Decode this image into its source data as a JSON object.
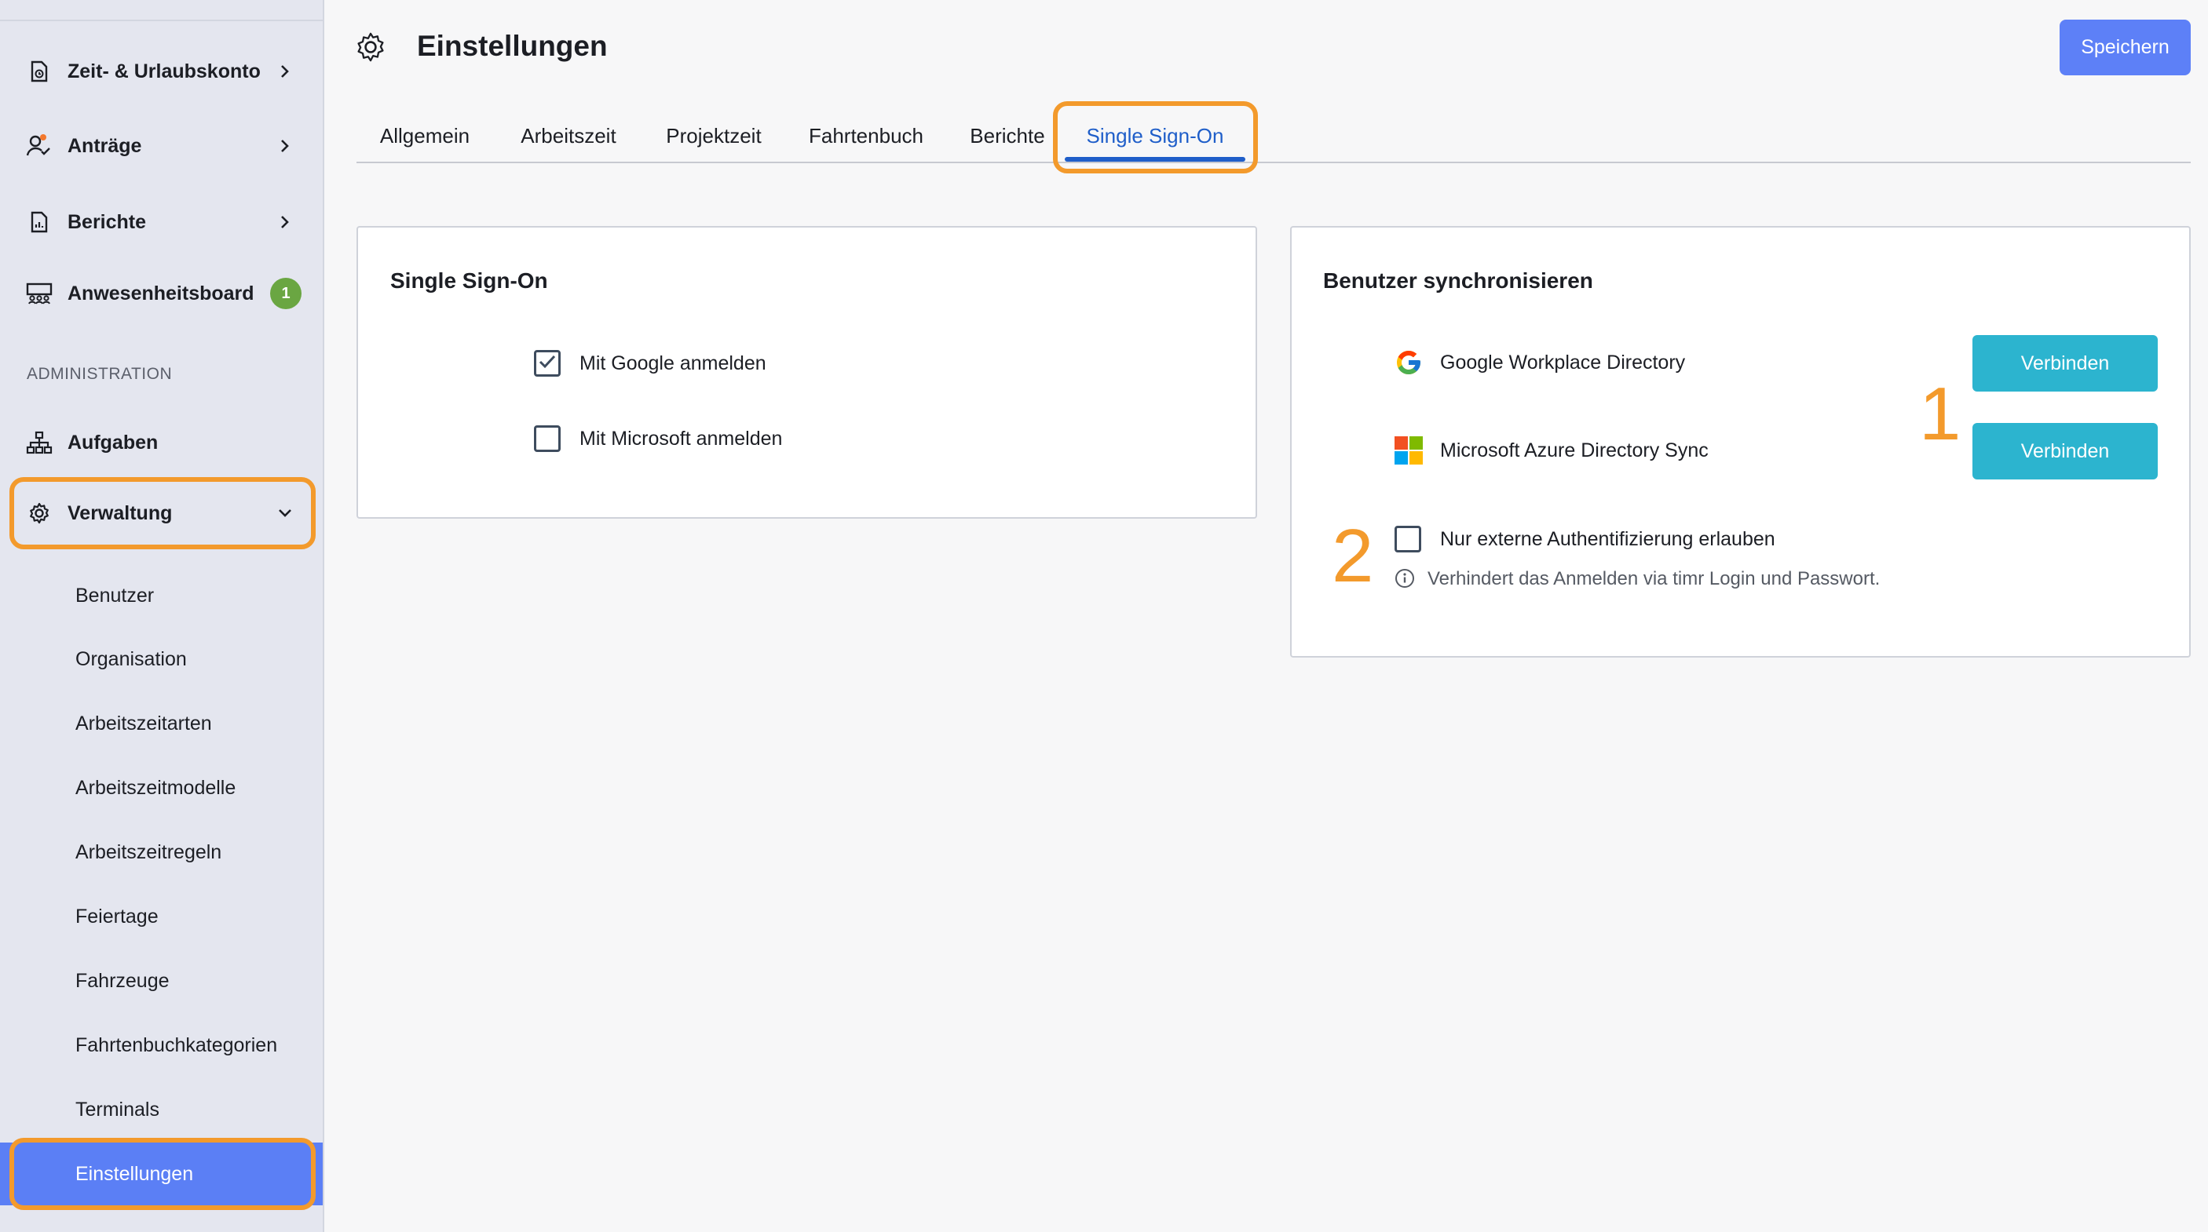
{
  "sidebar": {
    "items": [
      {
        "label": "Zeit- & Urlaubskonto",
        "icon": "document-clock-icon"
      },
      {
        "label": "Anträge",
        "icon": "user-check-icon"
      },
      {
        "label": "Berichte",
        "icon": "report-document-icon"
      },
      {
        "label": "Anwesenheitsboard",
        "icon": "presence-board-icon",
        "badge": "1"
      }
    ],
    "section_label": "ADMINISTRATION",
    "admin_items": [
      {
        "label": "Aufgaben",
        "icon": "hierarchy-icon"
      },
      {
        "label": "Verwaltung",
        "icon": "gear-icon"
      }
    ],
    "sub_items": [
      "Benutzer",
      "Organisation",
      "Arbeitszeitarten",
      "Arbeitszeitmodelle",
      "Arbeitszeitregeln",
      "Feiertage",
      "Fahrzeuge",
      "Fahrtenbuchkategorien",
      "Terminals",
      "Einstellungen"
    ],
    "active_sub_item": "Einstellungen"
  },
  "header": {
    "title": "Einstellungen",
    "save_label": "Speichern"
  },
  "tabs": [
    {
      "label": "Allgemein"
    },
    {
      "label": "Arbeitszeit"
    },
    {
      "label": "Projektzeit"
    },
    {
      "label": "Fahrtenbuch"
    },
    {
      "label": "Berichte"
    },
    {
      "label": "Single Sign-On"
    }
  ],
  "active_tab": "Single Sign-On",
  "sso_card": {
    "title": "Single Sign-On",
    "google": {
      "label": "Mit Google anmelden",
      "checked": true
    },
    "microsoft": {
      "label": "Mit Microsoft anmelden",
      "checked": false
    }
  },
  "sync_card": {
    "title": "Benutzer synchronisieren",
    "google_dir": {
      "label": "Google Workplace Directory",
      "button": "Verbinden"
    },
    "azure_dir": {
      "label": "Microsoft Azure Directory Sync",
      "button": "Verbinden"
    },
    "external_only": {
      "label": "Nur externe Authentifizierung erlauben",
      "checked": false
    },
    "hint": "Verhindert das Anmelden via timr Login und Passwort."
  },
  "annotations": {
    "step_1": "1",
    "step_2": "2"
  },
  "colors": {
    "accent": "#5d80f7",
    "connect": "#2cb4cf",
    "highlight": "#f39a2c",
    "tab_active": "#1f5ec9",
    "badge": "#6aa642"
  }
}
